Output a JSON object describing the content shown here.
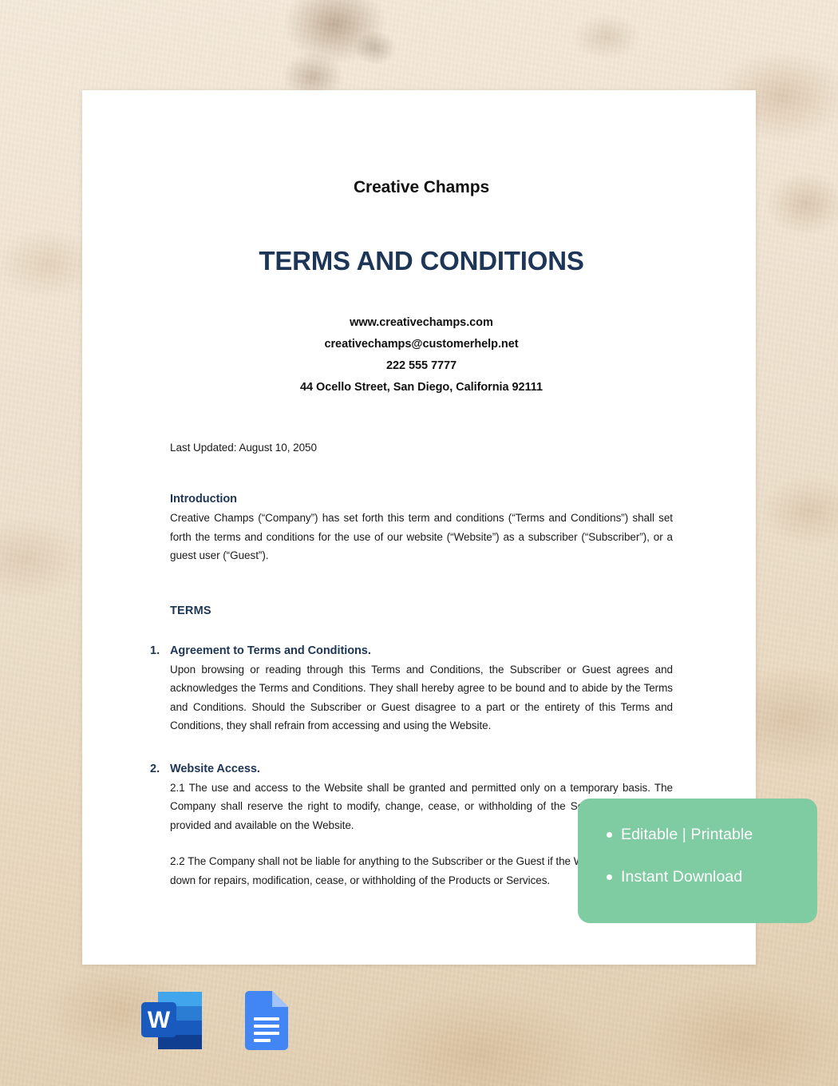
{
  "document": {
    "company_name": "Creative Champs",
    "title": "TERMS AND CONDITIONS",
    "contact": {
      "website": "www.creativechamps.com",
      "email": "creativechamps@customerhelp.net",
      "phone": "222 555 7777",
      "address": "44 Ocello Street, San Diego, California 92111"
    },
    "last_updated": "Last Updated: August 10, 2050",
    "intro": {
      "heading": "Introduction",
      "body": "Creative Champs (“Company”) has set forth this term and conditions (“Terms and Conditions”) shall set forth the terms and conditions for the use of our website (“Website”) as a subscriber (“Subscriber”), or a guest user (“Guest”)."
    },
    "terms_heading": "TERMS",
    "sections": [
      {
        "number": "1.",
        "title": "Agreement to Terms and Conditions.",
        "body": "Upon browsing or reading through this Terms and Conditions, the Subscriber or Guest agrees and acknowledges the Terms and Conditions. They shall hereby agree to be bound and to abide by the Terms and Conditions. Should the Subscriber or Guest disagree to a part or the entirety of this Terms and Conditions, they shall refrain from accessing and using the Website."
      },
      {
        "number": "2.",
        "title": "Website Access.",
        "paragraphs": [
          "2.1 The use and access to the Website shall be granted and permitted only on a temporary basis. The Company shall reserve the right to modify, change, cease, or withholding of the Services or Products provided and available on the Website.",
          "2.2 The Company shall not be liable for anything to the Subscriber or the Guest if the Website shall be down for repairs, modification, cease, or withholding of the Products or Services."
        ]
      }
    ]
  },
  "promo_badge": {
    "color": "#7fcba2",
    "text_color": "#ffffff",
    "items": [
      "Editable | Printable",
      "Instant Download"
    ]
  },
  "format_icons": [
    {
      "name": "microsoft-word",
      "letter": "W",
      "color": "#185abd"
    },
    {
      "name": "google-docs",
      "color": "#4285f4"
    }
  ],
  "colors": {
    "heading_navy": "#1d3557",
    "body_black": "#1a1a1a",
    "page_white": "#ffffff",
    "background_beige": "#ecdfcb",
    "badge_green": "#7fcba2"
  }
}
